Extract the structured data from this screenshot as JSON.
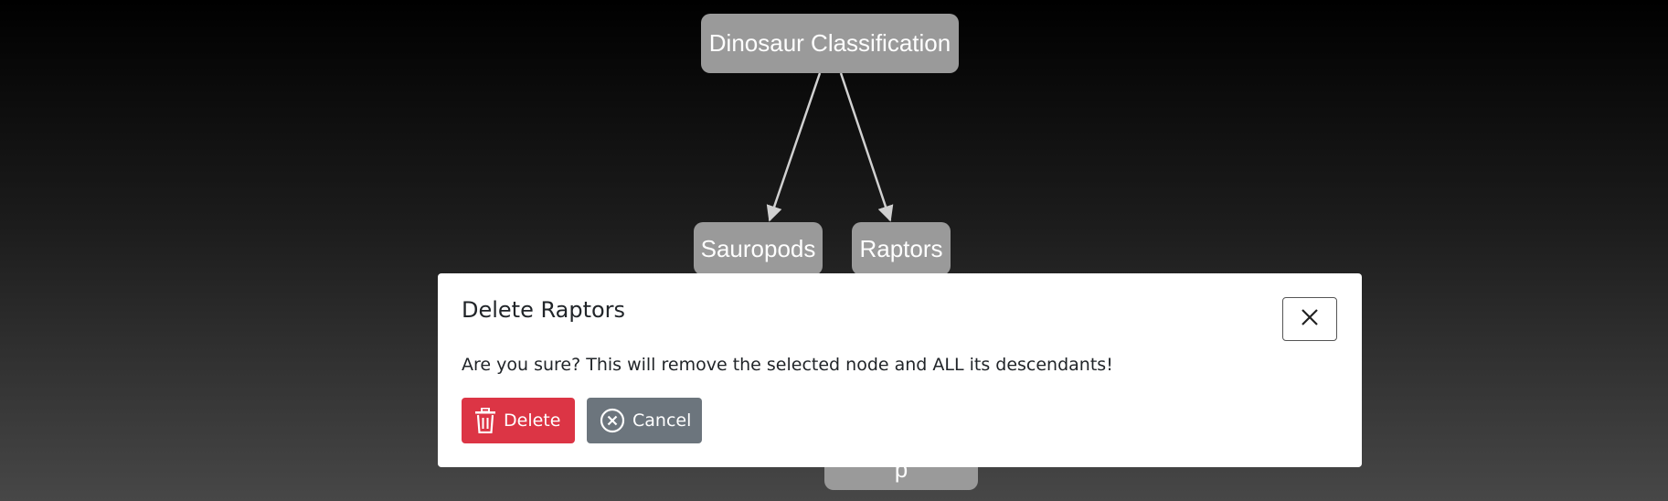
{
  "tree": {
    "root": "Dinosaur Classification",
    "children": [
      "Sauropods",
      "Raptors"
    ],
    "hidden_node_label": "p"
  },
  "modal": {
    "title": "Delete Raptors",
    "message": "Are you sure? This will remove the selected node and ALL its descendants!",
    "delete_label": "Delete",
    "cancel_label": "Cancel",
    "close_icon": "close-icon",
    "delete_icon": "trash-icon",
    "cancel_icon": "x-circle-icon",
    "colors": {
      "delete": "#dc3545",
      "cancel": "#6c757d",
      "node": "#9a9a9a"
    }
  }
}
